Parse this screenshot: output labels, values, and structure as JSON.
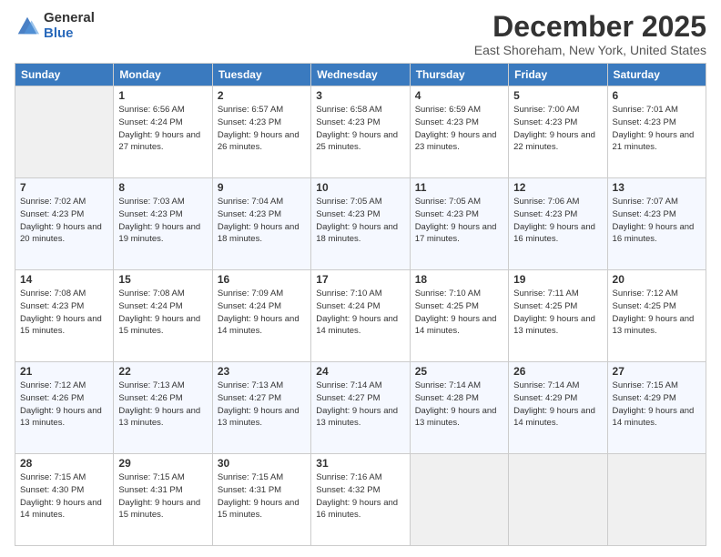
{
  "logo": {
    "general": "General",
    "blue": "Blue"
  },
  "title": "December 2025",
  "subtitle": "East Shoreham, New York, United States",
  "headers": [
    "Sunday",
    "Monday",
    "Tuesday",
    "Wednesday",
    "Thursday",
    "Friday",
    "Saturday"
  ],
  "weeks": [
    [
      {
        "day": "",
        "sunrise": "",
        "sunset": "",
        "daylight": ""
      },
      {
        "day": "1",
        "sunrise": "Sunrise: 6:56 AM",
        "sunset": "Sunset: 4:24 PM",
        "daylight": "Daylight: 9 hours and 27 minutes."
      },
      {
        "day": "2",
        "sunrise": "Sunrise: 6:57 AM",
        "sunset": "Sunset: 4:23 PM",
        "daylight": "Daylight: 9 hours and 26 minutes."
      },
      {
        "day": "3",
        "sunrise": "Sunrise: 6:58 AM",
        "sunset": "Sunset: 4:23 PM",
        "daylight": "Daylight: 9 hours and 25 minutes."
      },
      {
        "day": "4",
        "sunrise": "Sunrise: 6:59 AM",
        "sunset": "Sunset: 4:23 PM",
        "daylight": "Daylight: 9 hours and 23 minutes."
      },
      {
        "day": "5",
        "sunrise": "Sunrise: 7:00 AM",
        "sunset": "Sunset: 4:23 PM",
        "daylight": "Daylight: 9 hours and 22 minutes."
      },
      {
        "day": "6",
        "sunrise": "Sunrise: 7:01 AM",
        "sunset": "Sunset: 4:23 PM",
        "daylight": "Daylight: 9 hours and 21 minutes."
      }
    ],
    [
      {
        "day": "7",
        "sunrise": "Sunrise: 7:02 AM",
        "sunset": "Sunset: 4:23 PM",
        "daylight": "Daylight: 9 hours and 20 minutes."
      },
      {
        "day": "8",
        "sunrise": "Sunrise: 7:03 AM",
        "sunset": "Sunset: 4:23 PM",
        "daylight": "Daylight: 9 hours and 19 minutes."
      },
      {
        "day": "9",
        "sunrise": "Sunrise: 7:04 AM",
        "sunset": "Sunset: 4:23 PM",
        "daylight": "Daylight: 9 hours and 18 minutes."
      },
      {
        "day": "10",
        "sunrise": "Sunrise: 7:05 AM",
        "sunset": "Sunset: 4:23 PM",
        "daylight": "Daylight: 9 hours and 18 minutes."
      },
      {
        "day": "11",
        "sunrise": "Sunrise: 7:05 AM",
        "sunset": "Sunset: 4:23 PM",
        "daylight": "Daylight: 9 hours and 17 minutes."
      },
      {
        "day": "12",
        "sunrise": "Sunrise: 7:06 AM",
        "sunset": "Sunset: 4:23 PM",
        "daylight": "Daylight: 9 hours and 16 minutes."
      },
      {
        "day": "13",
        "sunrise": "Sunrise: 7:07 AM",
        "sunset": "Sunset: 4:23 PM",
        "daylight": "Daylight: 9 hours and 16 minutes."
      }
    ],
    [
      {
        "day": "14",
        "sunrise": "Sunrise: 7:08 AM",
        "sunset": "Sunset: 4:23 PM",
        "daylight": "Daylight: 9 hours and 15 minutes."
      },
      {
        "day": "15",
        "sunrise": "Sunrise: 7:08 AM",
        "sunset": "Sunset: 4:24 PM",
        "daylight": "Daylight: 9 hours and 15 minutes."
      },
      {
        "day": "16",
        "sunrise": "Sunrise: 7:09 AM",
        "sunset": "Sunset: 4:24 PM",
        "daylight": "Daylight: 9 hours and 14 minutes."
      },
      {
        "day": "17",
        "sunrise": "Sunrise: 7:10 AM",
        "sunset": "Sunset: 4:24 PM",
        "daylight": "Daylight: 9 hours and 14 minutes."
      },
      {
        "day": "18",
        "sunrise": "Sunrise: 7:10 AM",
        "sunset": "Sunset: 4:25 PM",
        "daylight": "Daylight: 9 hours and 14 minutes."
      },
      {
        "day": "19",
        "sunrise": "Sunrise: 7:11 AM",
        "sunset": "Sunset: 4:25 PM",
        "daylight": "Daylight: 9 hours and 13 minutes."
      },
      {
        "day": "20",
        "sunrise": "Sunrise: 7:12 AM",
        "sunset": "Sunset: 4:25 PM",
        "daylight": "Daylight: 9 hours and 13 minutes."
      }
    ],
    [
      {
        "day": "21",
        "sunrise": "Sunrise: 7:12 AM",
        "sunset": "Sunset: 4:26 PM",
        "daylight": "Daylight: 9 hours and 13 minutes."
      },
      {
        "day": "22",
        "sunrise": "Sunrise: 7:13 AM",
        "sunset": "Sunset: 4:26 PM",
        "daylight": "Daylight: 9 hours and 13 minutes."
      },
      {
        "day": "23",
        "sunrise": "Sunrise: 7:13 AM",
        "sunset": "Sunset: 4:27 PM",
        "daylight": "Daylight: 9 hours and 13 minutes."
      },
      {
        "day": "24",
        "sunrise": "Sunrise: 7:14 AM",
        "sunset": "Sunset: 4:27 PM",
        "daylight": "Daylight: 9 hours and 13 minutes."
      },
      {
        "day": "25",
        "sunrise": "Sunrise: 7:14 AM",
        "sunset": "Sunset: 4:28 PM",
        "daylight": "Daylight: 9 hours and 13 minutes."
      },
      {
        "day": "26",
        "sunrise": "Sunrise: 7:14 AM",
        "sunset": "Sunset: 4:29 PM",
        "daylight": "Daylight: 9 hours and 14 minutes."
      },
      {
        "day": "27",
        "sunrise": "Sunrise: 7:15 AM",
        "sunset": "Sunset: 4:29 PM",
        "daylight": "Daylight: 9 hours and 14 minutes."
      }
    ],
    [
      {
        "day": "28",
        "sunrise": "Sunrise: 7:15 AM",
        "sunset": "Sunset: 4:30 PM",
        "daylight": "Daylight: 9 hours and 14 minutes."
      },
      {
        "day": "29",
        "sunrise": "Sunrise: 7:15 AM",
        "sunset": "Sunset: 4:31 PM",
        "daylight": "Daylight: 9 hours and 15 minutes."
      },
      {
        "day": "30",
        "sunrise": "Sunrise: 7:15 AM",
        "sunset": "Sunset: 4:31 PM",
        "daylight": "Daylight: 9 hours and 15 minutes."
      },
      {
        "day": "31",
        "sunrise": "Sunrise: 7:16 AM",
        "sunset": "Sunset: 4:32 PM",
        "daylight": "Daylight: 9 hours and 16 minutes."
      },
      {
        "day": "",
        "sunrise": "",
        "sunset": "",
        "daylight": ""
      },
      {
        "day": "",
        "sunrise": "",
        "sunset": "",
        "daylight": ""
      },
      {
        "day": "",
        "sunrise": "",
        "sunset": "",
        "daylight": ""
      }
    ]
  ]
}
